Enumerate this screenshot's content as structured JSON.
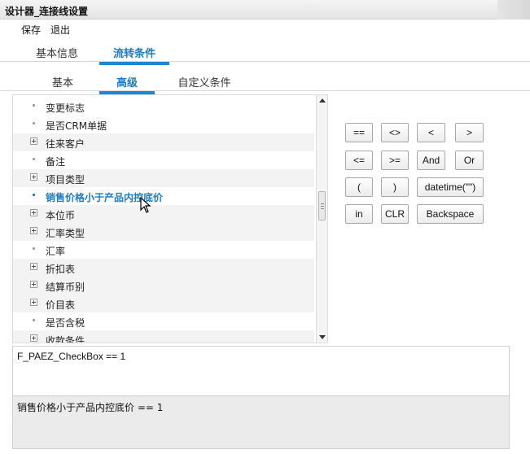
{
  "window": {
    "title": "设计器_连接线设置"
  },
  "menu": {
    "save": "保存",
    "exit": "退出"
  },
  "tabs_top": [
    {
      "label": "基本信息"
    },
    {
      "label": "流转条件"
    }
  ],
  "tabs_sub": [
    {
      "label": "基本"
    },
    {
      "label": "高级"
    },
    {
      "label": "自定义条件"
    }
  ],
  "tree": {
    "items": [
      {
        "label": "变更标志",
        "type": "leaf"
      },
      {
        "label": "是否CRM单据",
        "type": "leaf"
      },
      {
        "label": "往来客户",
        "type": "expandable"
      },
      {
        "label": "备注",
        "type": "leaf"
      },
      {
        "label": "项目类型",
        "type": "expandable"
      },
      {
        "label": "销售价格小于产品内控底价",
        "type": "leaf",
        "selected": true
      },
      {
        "label": "本位币",
        "type": "expandable"
      },
      {
        "label": "汇率类型",
        "type": "expandable"
      },
      {
        "label": "汇率",
        "type": "leaf"
      },
      {
        "label": "折扣表",
        "type": "expandable"
      },
      {
        "label": "结算币别",
        "type": "expandable"
      },
      {
        "label": "价目表",
        "type": "expandable"
      },
      {
        "label": "是否含税",
        "type": "leaf"
      },
      {
        "label": "收款条件",
        "type": "expandable"
      }
    ]
  },
  "operators": {
    "eq": "==",
    "ne": "<>",
    "lt": "<",
    "gt": ">",
    "le": "<=",
    "ge": ">=",
    "and": "And",
    "or": "Or",
    "lparen": "(",
    "rparen": ")",
    "datetime": "datetime(\"\")",
    "in": "in",
    "clr": "CLR",
    "backspace": "Backspace"
  },
  "expression": {
    "text": "F_PAEZ_CheckBox == 1"
  },
  "description": {
    "text": "销售价格小于产品内控底价  == 1"
  },
  "colors": {
    "accent": "#1e87d4",
    "selected_text": "#1a7cc4"
  }
}
